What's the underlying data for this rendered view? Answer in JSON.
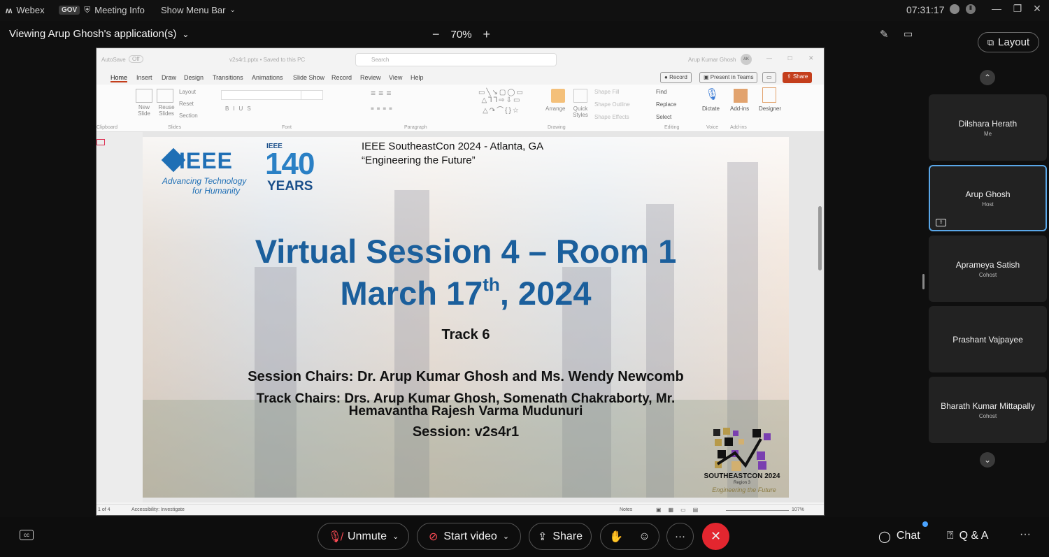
{
  "topbar": {
    "app_name": "Webex",
    "gov_badge": "GOV",
    "meeting_info": "Meeting Info",
    "show_menu_bar": "Show Menu Bar",
    "time": "07:31:17"
  },
  "viewbar": {
    "viewing_label": "Viewing Arup Ghosh's application(s)",
    "zoom": "70%",
    "zoom_out": "−",
    "zoom_in": "+"
  },
  "ppt": {
    "autosave": "AutoSave",
    "autosave_state": "Off",
    "filename": "v2s4r1.pptx • Saved to this PC",
    "search": "Search",
    "user": "Arup Kumar Ghosh",
    "user_initials": "AK",
    "tabs": [
      "Home",
      "Insert",
      "Draw",
      "Design",
      "Transitions",
      "Animations",
      "Slide Show",
      "Record",
      "Review",
      "View",
      "Help"
    ],
    "record_btn": "Record",
    "present_btn": "Present in Teams",
    "share_btn": "Share",
    "groups": [
      "Clipboard",
      "Slides",
      "Font",
      "Paragraph",
      "Drawing",
      "Editing",
      "Voice",
      "Add-ins"
    ],
    "ribbon_items": {
      "new_slide": "New Slide",
      "reuse_slides": "Reuse Slides",
      "layout": "Layout",
      "reset": "Reset",
      "section": "Section",
      "arrange": "Arrange",
      "quick_styles": "Quick Styles",
      "shape_fill": "Shape Fill",
      "shape_outline": "Shape Outline",
      "shape_effects": "Shape Effects",
      "find": "Find",
      "replace": "Replace",
      "select": "Select",
      "dictate": "Dictate",
      "add_ins": "Add-ins",
      "designer": "Designer"
    },
    "status_left": "1 of 4",
    "accessibility": "Accessibility: Investigate",
    "notes": "Notes",
    "zoom_pct": "107%"
  },
  "slide": {
    "ieee": "IEEE",
    "ieee_tag1": "Advancing Technology",
    "ieee_tag2": "for Humanity",
    "anniv_ieee": "IEEE",
    "anniv_num": "140",
    "anniv_years": "YEARS",
    "conf_line1": "IEEE SoutheastCon 2024 - Atlanta, GA",
    "conf_line2": "“Engineering the Future”",
    "title_line1": "Virtual Session 4 – Room 1",
    "title_line2_a": "March 17",
    "title_line2_sup": "th",
    "title_line2_b": ", 2024",
    "track": "Track 6",
    "session_chairs": "Session Chairs: Dr. Arup Kumar Ghosh and Ms. Wendy Newcomb",
    "track_chairs_1": "Track Chairs: Drs. Arup Kumar Ghosh, Somenath Chakraborty, Mr.",
    "track_chairs_2": "Hemavantha Rajesh Varma Mudunuri",
    "session_id": "Session: v2s4r1",
    "secon_name": "SOUTHEASTCON 2024",
    "secon_region": "Region 3",
    "secon_tag": "Engineering the Future"
  },
  "panel": {
    "layout_label": "Layout",
    "participants": [
      {
        "name": "Dilshara Herath",
        "role": "Me"
      },
      {
        "name": "Arup Ghosh",
        "role": "Host"
      },
      {
        "name": "Aprameya Satish",
        "role": "Cohost"
      },
      {
        "name": "Prashant Vajpayee",
        "role": ""
      },
      {
        "name": "Bharath Kumar Mittapally",
        "role": "Cohost"
      }
    ]
  },
  "bottombar": {
    "unmute": "Unmute",
    "start_video": "Start video",
    "share": "Share",
    "chat": "Chat",
    "qa": "Q & A",
    "more": "···"
  },
  "colors": {
    "accent": "#5aa7e8",
    "end_call": "#e3262f",
    "ieee_blue": "#1b5f9c"
  }
}
